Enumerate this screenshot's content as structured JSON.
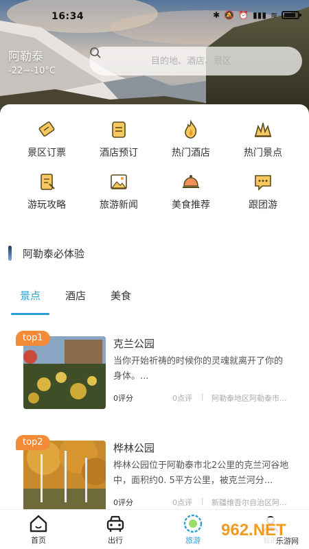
{
  "status_bar": {
    "time": "16:34"
  },
  "header": {
    "city": "阿勒泰",
    "temperature": "-22~-10°C",
    "search_placeholder": "目的地、酒店、景区"
  },
  "grid": [
    {
      "label": "景区订票",
      "icon": "ticket-icon"
    },
    {
      "label": "酒店预订",
      "icon": "hotel-booking-icon"
    },
    {
      "label": "热门酒店",
      "icon": "flame-icon"
    },
    {
      "label": "热门景点",
      "icon": "landmark-icon"
    },
    {
      "label": "游玩攻略",
      "icon": "guide-icon"
    },
    {
      "label": "旅游新闻",
      "icon": "news-image-icon"
    },
    {
      "label": "美食推荐",
      "icon": "food-cloche-icon"
    },
    {
      "label": "跟团游",
      "icon": "chat-group-icon"
    }
  ],
  "section": {
    "title": "阿勒泰必体验"
  },
  "tabs": [
    {
      "label": "景点",
      "active": true
    },
    {
      "label": "酒店",
      "active": false
    },
    {
      "label": "美食",
      "active": false
    }
  ],
  "items": [
    {
      "badge": "top1",
      "title": "克兰公园",
      "desc": "当你开始祈祷的时候你的灵魂就离开了你的身体。...",
      "score": "0评分",
      "reviews": "0点评",
      "location": "阿勒泰地区阿勒泰市..."
    },
    {
      "badge": "top2",
      "title": "桦林公园",
      "desc": "桦林公园位于阿勒泰市北2公里的克兰河谷地中，面积约0. 5平方公里，被克兰河分...",
      "score": "0评分",
      "reviews": "0点评",
      "location": "新疆维吾尔自治区阿..."
    }
  ],
  "bottom_nav": [
    {
      "label": "首页",
      "icon": "home-icon",
      "active": false
    },
    {
      "label": "出行",
      "icon": "car-icon",
      "active": false
    },
    {
      "label": "旅游",
      "icon": "travel-icon",
      "active": true
    },
    {
      "label": "我的",
      "icon": "profile-icon",
      "active": false
    }
  ],
  "watermark": {
    "text": "962.NET",
    "subtext": "乐游网"
  },
  "colors": {
    "accent": "#2a9fd6",
    "badge": "#f28a37",
    "icon": "#f4a62a"
  }
}
